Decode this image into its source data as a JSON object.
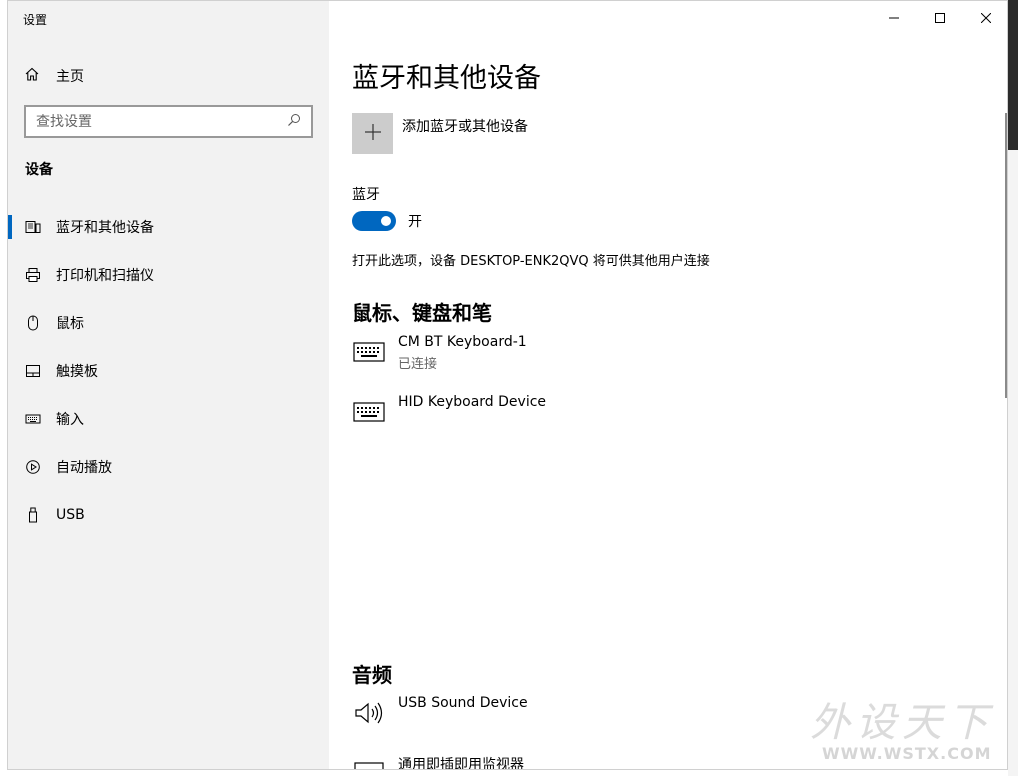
{
  "app": {
    "title": "设置"
  },
  "window_controls": {
    "minimize": "minimize-icon",
    "maximize": "maximize-icon",
    "close": "close-icon"
  },
  "sidebar": {
    "home_label": "主页",
    "search": {
      "placeholder": "查找设置",
      "value": ""
    },
    "section_label": "设备",
    "items": [
      {
        "label": "蓝牙和其他设备",
        "icon": "bluetooth-devices-icon",
        "active": true
      },
      {
        "label": "打印机和扫描仪",
        "icon": "printer-icon",
        "active": false
      },
      {
        "label": "鼠标",
        "icon": "mouse-icon",
        "active": false
      },
      {
        "label": "触摸板",
        "icon": "touchpad-icon",
        "active": false
      },
      {
        "label": "输入",
        "icon": "keyboard-icon",
        "active": false
      },
      {
        "label": "自动播放",
        "icon": "autoplay-icon",
        "active": false
      },
      {
        "label": "USB",
        "icon": "usb-icon",
        "active": false
      }
    ]
  },
  "main": {
    "title": "蓝牙和其他设备",
    "add_device_label": "添加蓝牙或其他设备",
    "bluetooth": {
      "label": "蓝牙",
      "state_text": "开",
      "enabled": true,
      "description": "打开此选项，设备 DESKTOP-ENK2QVQ 将可供其他用户连接"
    },
    "input_section": {
      "title": "鼠标、键盘和笔",
      "devices": [
        {
          "name": "CM BT Keyboard-1",
          "status": "已连接",
          "icon": "keyboard-icon"
        },
        {
          "name": "HID Keyboard Device",
          "status": "",
          "icon": "keyboard-icon"
        }
      ]
    },
    "audio_section": {
      "title": "音频",
      "devices": [
        {
          "name": "USB Sound Device",
          "status": "",
          "icon": "speaker-icon"
        },
        {
          "name": "通用即插即用监视器",
          "status": "",
          "icon": "monitor-icon"
        }
      ]
    }
  },
  "watermark": {
    "cn": "外设天下",
    "en": "WWW.WSTX.COM"
  },
  "colors": {
    "accent": "#0067c0",
    "sidebar_bg": "#f2f2f2",
    "add_tile": "#cccccc"
  }
}
